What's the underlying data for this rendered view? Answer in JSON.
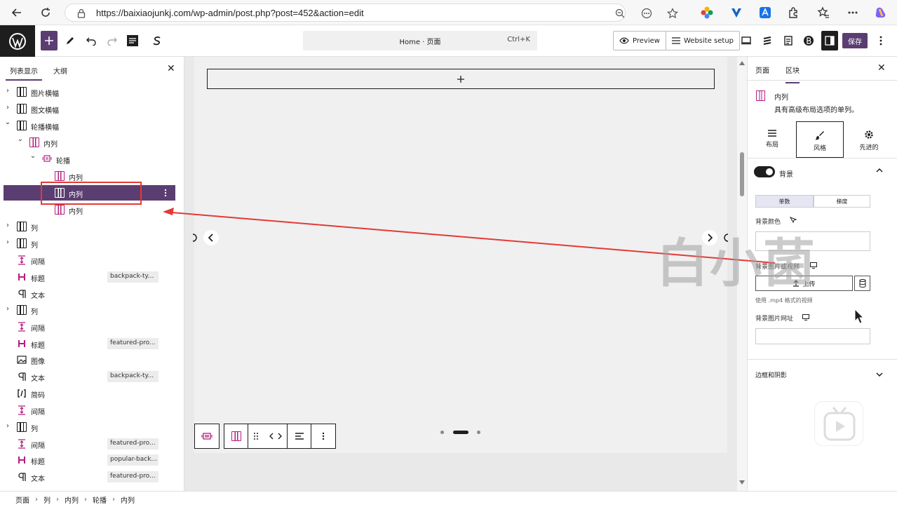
{
  "browser": {
    "url": "https://baixiaojunkj.com/wp-admin/post.php?post=452&action=edit"
  },
  "toolbar": {
    "doc_title": "Home · 页面",
    "doc_shortcut": "Ctrl+K",
    "preview_label": "Preview",
    "website_setup_label": "Website setup",
    "save_label": "保存"
  },
  "left_panel": {
    "tab_list": "列表显示",
    "tab_outline": "大纲",
    "rows": [
      {
        "label": "图片横幅",
        "badge": ""
      },
      {
        "label": "图文横幅",
        "badge": ""
      },
      {
        "label": "轮播横幅",
        "badge": ""
      },
      {
        "label": "内列",
        "badge": ""
      },
      {
        "label": "轮播",
        "badge": ""
      },
      {
        "label": "内列",
        "badge": ""
      },
      {
        "label": "内列",
        "badge": ""
      },
      {
        "label": "内列",
        "badge": ""
      },
      {
        "label": "列",
        "badge": ""
      },
      {
        "label": "列",
        "badge": ""
      },
      {
        "label": "间隔",
        "badge": ""
      },
      {
        "label": "标题",
        "badge": "backpack-ty..."
      },
      {
        "label": "文本",
        "badge": ""
      },
      {
        "label": "列",
        "badge": ""
      },
      {
        "label": "间隔",
        "badge": ""
      },
      {
        "label": "标题",
        "badge": "featured-pro..."
      },
      {
        "label": "图像",
        "badge": ""
      },
      {
        "label": "文本",
        "badge": "backpack-ty..."
      },
      {
        "label": "简码",
        "badge": ""
      },
      {
        "label": "间隔",
        "badge": ""
      },
      {
        "label": "列",
        "badge": ""
      },
      {
        "label": "间隔",
        "badge": "featured-pro..."
      },
      {
        "label": "标题",
        "badge": "popular-back..."
      },
      {
        "label": "文本",
        "badge": "featured-pro..."
      }
    ]
  },
  "right_panel": {
    "tab_page": "页面",
    "tab_block": "区块",
    "block_name": "内列",
    "block_desc": "具有高级布局选项的单列。",
    "tab_layout": "布局",
    "tab_style": "风格",
    "tab_advanced": "先进的",
    "bg_title": "背景",
    "seg_single": "单数",
    "seg_gradient": "梯度",
    "bg_color_label": "背景颜色",
    "bg_media_label": "背景图片或视频",
    "upload_label": "上传",
    "video_hint": "使用 .mp4 格式的视频",
    "bg_url_label": "背景图片网址",
    "border_section": "边框和阴影"
  },
  "breadcrumb": [
    "页面",
    "列",
    "内列",
    "轮播",
    "内列"
  ],
  "overlay": {
    "watermark": "白小菌"
  },
  "colors": {
    "accent": "#5b3e71",
    "block_icon": "#b31e7f",
    "annotation": "#e53935"
  }
}
